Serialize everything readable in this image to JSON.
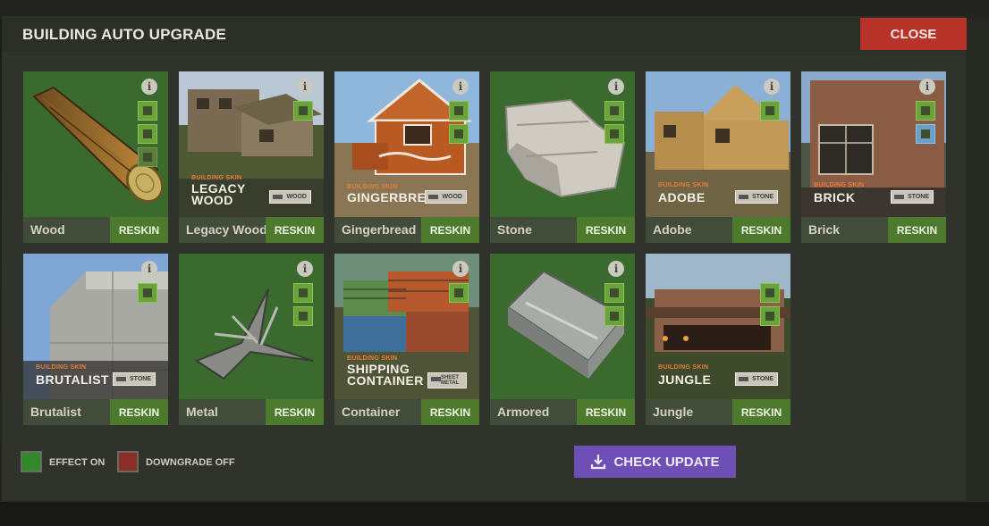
{
  "header": {
    "title": "BUILDING AUTO UPGRADE",
    "close_label": "CLOSE"
  },
  "cards": [
    {
      "name": "Wood",
      "reskin": "RESKIN",
      "skin_tag": "",
      "skin_name": "",
      "material": ""
    },
    {
      "name": "Legacy Wood",
      "reskin": "RESKIN",
      "skin_tag": "BUILDING SKIN",
      "skin_name": "LEGACY WOOD",
      "material": "WOOD"
    },
    {
      "name": "Gingerbread",
      "reskin": "RESKIN",
      "skin_tag": "BUILDING SKIN",
      "skin_name": "GINGERBREAD",
      "material": "WOOD"
    },
    {
      "name": "Stone",
      "reskin": "RESKIN",
      "skin_tag": "",
      "skin_name": "",
      "material": ""
    },
    {
      "name": "Adobe",
      "reskin": "RESKIN",
      "skin_tag": "BUILDING SKIN",
      "skin_name": "ADOBE",
      "material": "STONE"
    },
    {
      "name": "Brick",
      "reskin": "RESKIN",
      "skin_tag": "BUILDING SKIN",
      "skin_name": "BRICK",
      "material": "STONE"
    },
    {
      "name": "Brutalist",
      "reskin": "RESKIN",
      "skin_tag": "BUILDING SKIN",
      "skin_name": "BRUTALIST",
      "material": "STONE"
    },
    {
      "name": "Metal",
      "reskin": "RESKIN",
      "skin_tag": "",
      "skin_name": "",
      "material": ""
    },
    {
      "name": "Container",
      "reskin": "RESKIN",
      "skin_tag": "BUILDING SKIN",
      "skin_name": "SHIPPING CONTAINER",
      "material": "SHEET METAL"
    },
    {
      "name": "Armored",
      "reskin": "RESKIN",
      "skin_tag": "",
      "skin_name": "",
      "material": ""
    },
    {
      "name": "Jungle",
      "reskin": "RESKIN",
      "skin_tag": "BUILDING SKIN",
      "skin_name": "JUNGLE",
      "material": "STONE"
    }
  ],
  "legend": {
    "effect_label": "EFFECT ON",
    "effect_color": "#2f8a2c",
    "downgrade_label": "DOWNGRADE OFF",
    "downgrade_color": "#8a2e2a"
  },
  "check_update": {
    "label": "CHECK UPDATE",
    "icon": "download-icon"
  },
  "colors": {
    "reskin": "#4d7a2c",
    "close": "#b7332a",
    "check": "#6e4fb6",
    "option": "#6aa33a"
  }
}
